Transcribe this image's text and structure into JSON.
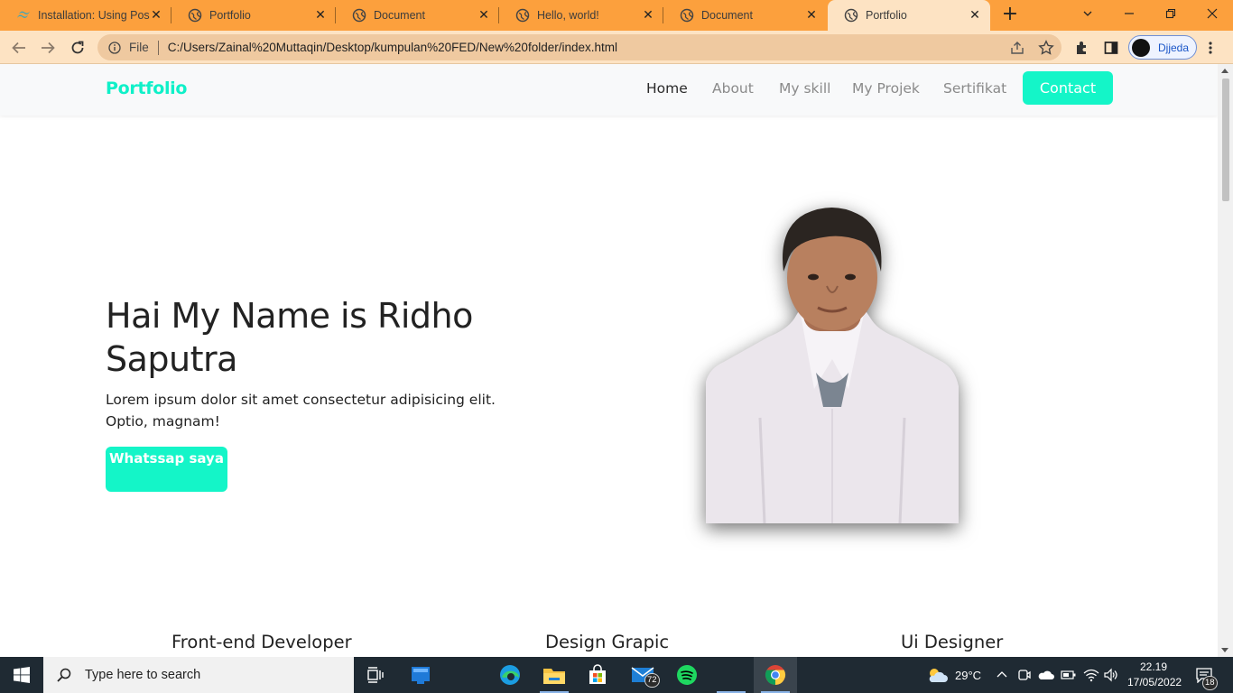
{
  "browser": {
    "tabs": [
      {
        "title": "Installation: Using Pos",
        "icon": "tailwind-icon",
        "active": false
      },
      {
        "title": "Portfolio",
        "icon": "globe-icon",
        "active": false
      },
      {
        "title": "Document",
        "icon": "globe-icon",
        "active": false
      },
      {
        "title": "Hello, world!",
        "icon": "globe-icon",
        "active": false
      },
      {
        "title": "Document",
        "icon": "globe-icon",
        "active": false
      },
      {
        "title": "Portfolio",
        "icon": "globe-icon",
        "active": true
      }
    ],
    "address": {
      "scheme_label": "File",
      "url": "C:/Users/Zainal%20Muttaqin/Desktop/kumpulan%20FED/New%20folder/index.html"
    },
    "profile_name": "Djjeda",
    "colors": {
      "frame": "#fca03d",
      "toolbar": "#fde3c3"
    }
  },
  "site": {
    "brand": "Portfolio",
    "nav": {
      "home": "Home",
      "about": "About",
      "skill": "My skill",
      "projek": "My Projek",
      "sertifikat": "Sertifikat",
      "contact": "Contact"
    },
    "hero": {
      "title": "Hai My Name is Ridho Saputra",
      "text": "Lorem ipsum dolor sit amet consectetur adipisicing elit. Optio, magnam!",
      "button": "Whatssap saya"
    },
    "skills": [
      "Front-end Developer",
      "Design Grapic",
      "Ui Designer"
    ],
    "colors": {
      "accent": "#14f5c8",
      "brand": "#0ff0c8"
    }
  },
  "taskbar": {
    "search_placeholder": "Type here to search",
    "mail_badge": "72",
    "weather": "29°C",
    "time": "22.19",
    "date": "17/05/2022",
    "notification_count": "18"
  }
}
